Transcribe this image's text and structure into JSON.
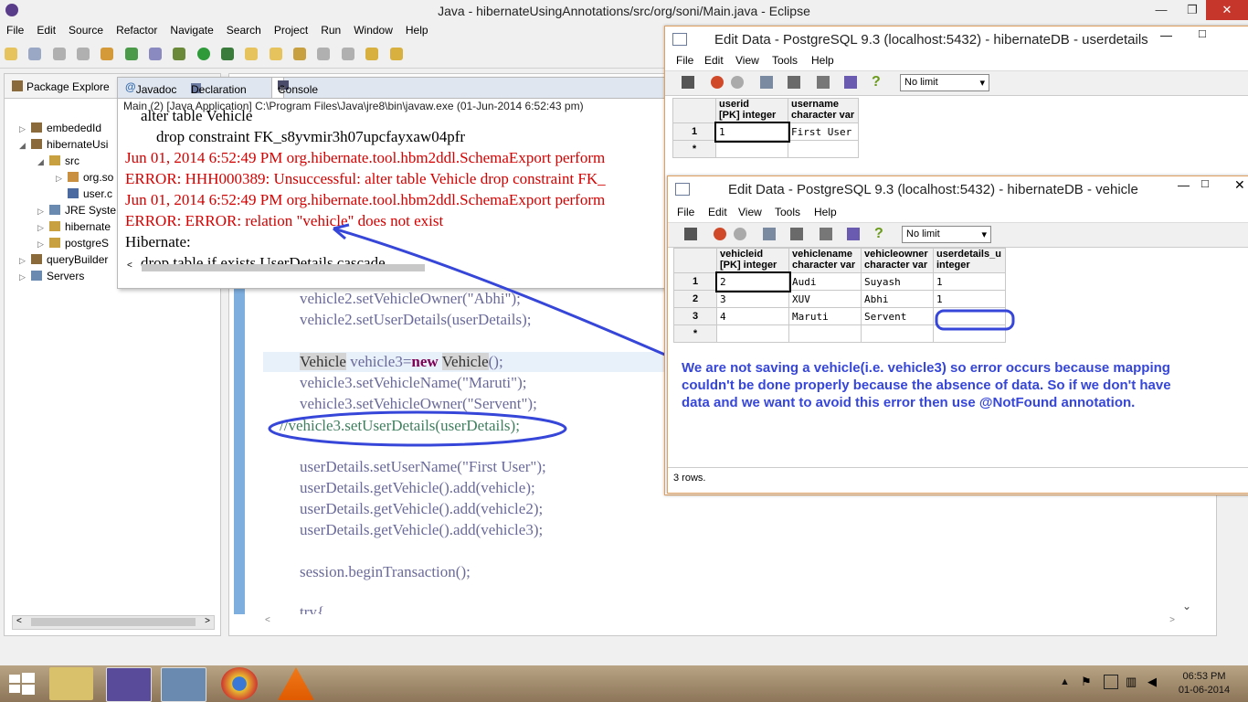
{
  "eclipse": {
    "title": "Java - hibernateUsingAnnotations/src/org/soni/Main.java - Eclipse",
    "menu": [
      "File",
      "Edit",
      "Source",
      "Refactor",
      "Navigate",
      "Search",
      "Project",
      "Run",
      "Window",
      "Help"
    ]
  },
  "package_explorer": {
    "tab_label": "Package Explore",
    "tree": [
      {
        "label": "embededId",
        "indent": 0,
        "twisty": "▷"
      },
      {
        "label": "hibernateUsi",
        "indent": 0,
        "twisty": "◢"
      },
      {
        "label": "src",
        "indent": 1,
        "twisty": "◢"
      },
      {
        "label": "org.so",
        "indent": 2,
        "twisty": "▷"
      },
      {
        "label": "user.c",
        "indent": 2,
        "twisty": ""
      },
      {
        "label": "JRE Syste",
        "indent": 1,
        "twisty": "▷"
      },
      {
        "label": "hibernate",
        "indent": 1,
        "twisty": "▷"
      },
      {
        "label": "postgreS",
        "indent": 1,
        "twisty": "▷"
      },
      {
        "label": "queryBuilder",
        "indent": 0,
        "twisty": "▷"
      },
      {
        "label": "Servers",
        "indent": 0,
        "twisty": "▷"
      }
    ]
  },
  "console": {
    "tabs": [
      "Javadoc",
      "Declaration",
      "Console"
    ],
    "status": "Main (2) [Java Application] C:\\Program Files\\Java\\jre8\\bin\\javaw.exe (01-Jun-2014 6:52:43 pm)",
    "lines": [
      {
        "text": "    alter table Vehicle",
        "red": false
      },
      {
        "text": "        drop constraint FK_s8yvmir3h07upcfayxaw04pfr",
        "red": false
      },
      {
        "text": "Jun 01, 2014 6:52:49 PM org.hibernate.tool.hbm2ddl.SchemaExport perform",
        "red": true
      },
      {
        "text": "ERROR: HHH000389: Unsuccessful: alter table Vehicle drop constraint FK_",
        "red": true
      },
      {
        "text": "Jun 01, 2014 6:52:49 PM org.hibernate.tool.hbm2ddl.SchemaExport perform",
        "red": true
      },
      {
        "text": "ERROR: ERROR: relation \"vehicle\" does not exist",
        "red": true
      },
      {
        "text": "Hibernate:",
        "red": false
      },
      {
        "text": "    drop table if exists UserDetails cascade",
        "red": false
      }
    ]
  },
  "code": {
    "l1": "vehicle2.setVehicleOwner(\"Abhi\");",
    "l2": "vehicle2.setUserDetails(userDetails);",
    "l3_a": "Vehicle",
    "l3_b": " vehicle3=",
    "l3_kw": "new",
    "l3_c": " ",
    "l3_d": "Vehicle",
    "l3_e": "();",
    "l4": "vehicle3.setVehicleName(\"Maruti\");",
    "l5": "vehicle3.setVehicleOwner(\"Servent\");",
    "l6": "//vehicle3.setUserDetails(userDetails);",
    "l7": "userDetails.setUserName(\"First User\");",
    "l8": "userDetails.getVehicle().add(vehicle);",
    "l9": "userDetails.getVehicle().add(vehicle2);",
    "l10": "userDetails.getVehicle().add(vehicle3);",
    "l11": "session.beginTransaction();",
    "l12": "try{"
  },
  "db_userdetails": {
    "title": "Edit Data - PostgreSQL 9.3 (localhost:5432) - hibernateDB - userdetails",
    "menu": [
      "File",
      "Edit",
      "View",
      "Tools",
      "Help"
    ],
    "limit": "No limit",
    "columns": [
      {
        "name": "userid",
        "type": "[PK] integer"
      },
      {
        "name": "username",
        "type": "character var"
      }
    ],
    "rows": [
      [
        "1",
        "1",
        "First User"
      ]
    ],
    "new_row_marker": "*"
  },
  "db_vehicle": {
    "title": "Edit Data - PostgreSQL 9.3 (localhost:5432) - hibernateDB - vehicle",
    "menu": [
      "File",
      "Edit",
      "View",
      "Tools",
      "Help"
    ],
    "limit": "No limit",
    "columns": [
      {
        "name": "vehicleid",
        "type": "[PK] integer"
      },
      {
        "name": "vehiclename",
        "type": "character var"
      },
      {
        "name": "vehicleowner",
        "type": "character var"
      },
      {
        "name": "userdetails_u",
        "type": "integer"
      }
    ],
    "rows": [
      [
        "1",
        "2",
        "Audi",
        "Suyash",
        "1"
      ],
      [
        "2",
        "3",
        "XUV",
        "Abhi",
        "1"
      ],
      [
        "3",
        "4",
        "Maruti",
        "Servent",
        ""
      ]
    ],
    "new_row_marker": "*",
    "status": "3 rows."
  },
  "annotation": "We are not saving a vehicle(i.e. vehicle3) so error occurs because mapping couldn't be done properly because the absence of data. So if we don't have data and we want to avoid this error then use @NotFound annotation.",
  "taskbar": {
    "time": "06:53 PM",
    "date": "01-06-2014",
    "apps": [
      "file-explorer",
      "java-ee-ide",
      "pgadmin",
      "chrome",
      "vlc"
    ]
  },
  "colors": {
    "annotation": "#3646d8",
    "error_text": "#d40000",
    "keyword": "#7f0055",
    "string": "#2a00ff",
    "comment": "#3f7f5f"
  }
}
